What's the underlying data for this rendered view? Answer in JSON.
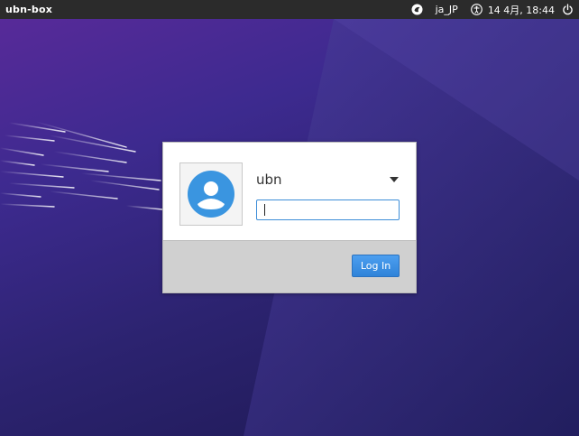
{
  "topbar": {
    "hostname": "ubn-box",
    "keyboard_layout": "ja_JP",
    "datetime": "14 4月, 18:44",
    "icons": {
      "session": "session-icon",
      "accessibility": "accessibility-icon",
      "power": "power-icon"
    }
  },
  "login": {
    "username": "ubn",
    "password_value": "",
    "login_button_label": "Log In",
    "avatar_icon": "user-avatar-icon"
  },
  "colors": {
    "topbar_bg": "#2b2b2b",
    "accent": "#3d8ed8",
    "avatar_blue": "#3a95e0",
    "background_primary": "#3d2a8f"
  }
}
